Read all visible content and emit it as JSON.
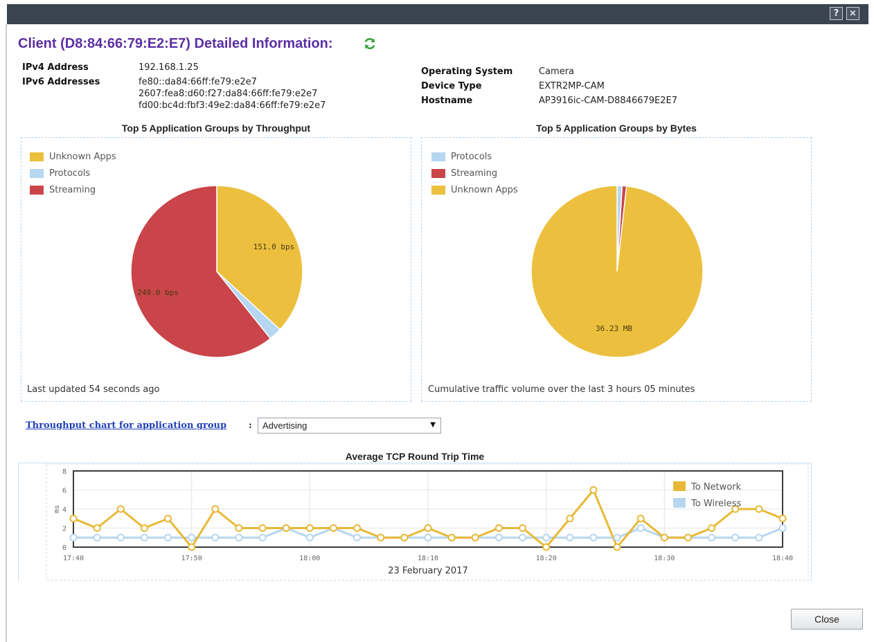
{
  "window": {
    "help_label": "?",
    "close_label": "×"
  },
  "heading": "Client (D8:84:66:79:E2:E7) Detailed Information:",
  "client": {
    "left": [
      {
        "label": "IPv4 Address",
        "values": [
          "192.168.1.25"
        ]
      },
      {
        "label": "IPv6 Addresses",
        "values": [
          "fe80::da84:66ff:fe79:e2e7",
          "2607:fea8:d60:f27:da84:66ff:fe79:e2e7",
          "fd00:bc4d:fbf3:49e2:da84:66ff:fe79:e2e7"
        ]
      }
    ],
    "right": [
      {
        "label": "Operating System",
        "values": [
          "Camera"
        ]
      },
      {
        "label": "Device Type",
        "values": [
          "EXTR2MP-CAM"
        ]
      },
      {
        "label": "Hostname",
        "values": [
          "AP3916ic-CAM-D8846679E2E7"
        ]
      }
    ]
  },
  "panels": {
    "throughput": {
      "title": "Top 5 Application Groups by Throughput",
      "footer": "Last updated 54 seconds ago"
    },
    "bytes": {
      "title": "Top 5 Application Groups by Bytes",
      "footer": "Cumulative traffic volume over the last 3 hours 05 minutes"
    }
  },
  "selector": {
    "link_label": "Throughput chart for application group",
    "colon": ":",
    "selected": "Advertising"
  },
  "close_button": "Close",
  "colors": {
    "unknown_apps": "#ecc03e",
    "protocols": "#b6d7f2",
    "streaming": "#c9454a",
    "to_network": "#e8b836",
    "to_wireless": "#b6d6f0",
    "heading": "#5b2fa3",
    "refresh_icon": "#3aa33a"
  },
  "icons": {
    "refresh": "refresh-icon"
  },
  "chart_data": [
    {
      "type": "pie",
      "title": "Top 5 Application Groups by Throughput",
      "legend": [
        "Unknown Apps",
        "Protocols",
        "Streaming"
      ],
      "slices": [
        {
          "name": "Unknown Apps",
          "value": 151.0,
          "label": "151.0 bps",
          "color": "#ecc03e"
        },
        {
          "name": "Protocols",
          "value": 10.0,
          "label": "",
          "color": "#b6d7f2"
        },
        {
          "name": "Streaming",
          "value": 249.0,
          "label": "249.0 bps",
          "color": "#c9454a"
        }
      ]
    },
    {
      "type": "pie",
      "title": "Top 5 Application Groups by Bytes",
      "legend": [
        "Protocols",
        "Streaming",
        "Unknown Apps"
      ],
      "slices": [
        {
          "name": "Protocols",
          "value": 0.35,
          "label": "",
          "color": "#b6d7f2"
        },
        {
          "name": "Streaming",
          "value": 0.3,
          "label": "",
          "color": "#c9454a"
        },
        {
          "name": "Unknown Apps",
          "value": 36.23,
          "label": "36.23 MB",
          "color": "#ecc03e"
        }
      ]
    },
    {
      "type": "line",
      "title": "Average TCP Round Trip Time",
      "xlabel": "23 February 2017",
      "ylabel": "ms",
      "ylim": [
        0,
        8
      ],
      "yticks": [
        0,
        2,
        4,
        6,
        8
      ],
      "x": [
        "17:40",
        "17:42",
        "17:44",
        "17:46",
        "17:48",
        "17:50",
        "17:52",
        "17:54",
        "17:56",
        "17:58",
        "18:00",
        "18:02",
        "18:04",
        "18:06",
        "18:08",
        "18:10",
        "18:12",
        "18:14",
        "18:16",
        "18:18",
        "18:20",
        "18:22",
        "18:24",
        "18:26",
        "18:28",
        "18:30",
        "18:32",
        "18:34",
        "18:36",
        "18:38",
        "18:40"
      ],
      "xticks": [
        "17:40",
        "17:50",
        "18:00",
        "18:10",
        "18:20",
        "18:30",
        "18:40"
      ],
      "grid": true,
      "legend_position": "top-right",
      "series": [
        {
          "name": "To Network",
          "color": "#e8b836",
          "values": [
            3,
            2,
            4,
            2,
            3,
            0,
            4,
            2,
            2,
            2,
            2,
            2,
            2,
            1,
            1,
            2,
            1,
            1,
            2,
            2,
            0,
            3,
            6,
            0,
            3,
            1,
            1,
            2,
            4,
            4,
            3
          ]
        },
        {
          "name": "To Wireless",
          "color": "#b6d6f0",
          "values": [
            1,
            1,
            1,
            1,
            1,
            1,
            1,
            1,
            1,
            2,
            1,
            2,
            1,
            1,
            1,
            1,
            1,
            1,
            1,
            1,
            1,
            1,
            1,
            1,
            2,
            1,
            1,
            1,
            1,
            1,
            2
          ]
        }
      ]
    }
  ]
}
